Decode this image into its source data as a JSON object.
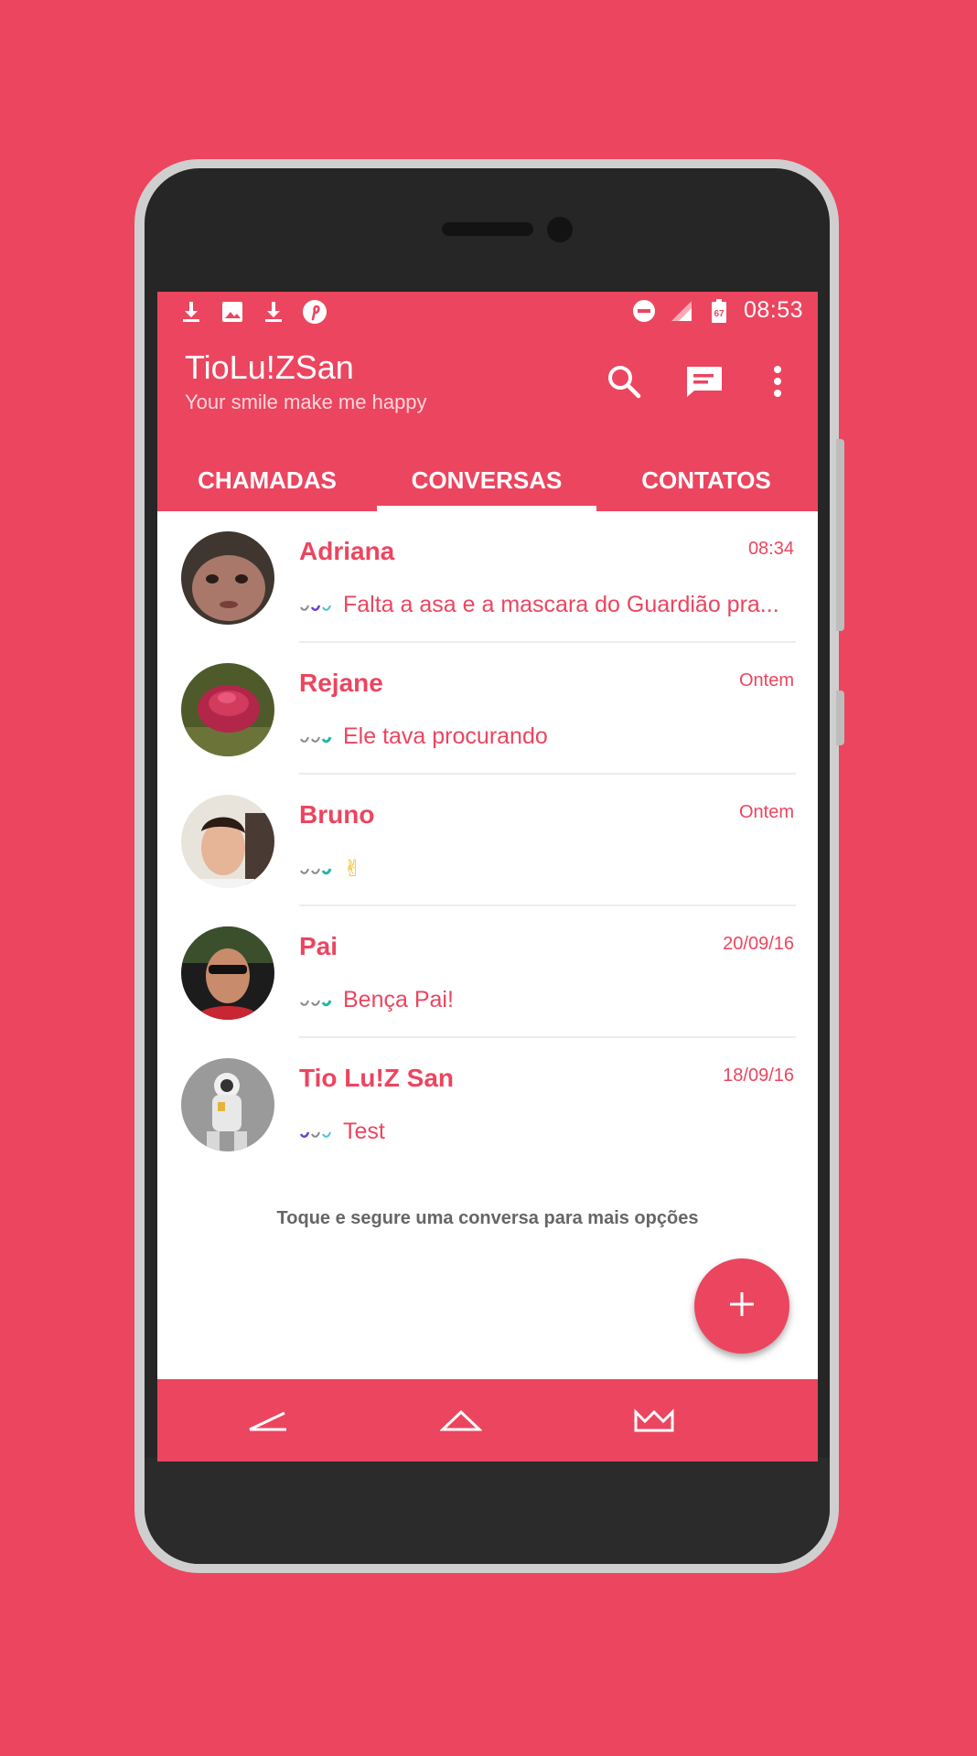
{
  "app": {
    "title": "TioLu!ZSan",
    "subtitle": "Your smile make me happy",
    "accent_color": "#ec455f"
  },
  "status_bar": {
    "time": "08:53",
    "left_icons": [
      "download-icon",
      "image-icon",
      "download-icon",
      "pinterest-icon"
    ],
    "right_icons": [
      "do-not-disturb-icon",
      "signal-icon",
      "battery-icon"
    ]
  },
  "toolbar": {
    "actions": [
      "search-icon",
      "new-message-icon",
      "more-vert-icon"
    ]
  },
  "tabs": [
    {
      "label": "CHAMADAS",
      "selected": false
    },
    {
      "label": "CONVERSAS",
      "selected": true
    },
    {
      "label": "CONTATOS",
      "selected": false
    }
  ],
  "chats": [
    {
      "name": "Adriana",
      "time": "08:34",
      "message": "Falta a asa e a mascara do Guardião pra..."
    },
    {
      "name": "Rejane",
      "time": "Ontem",
      "message": "Ele tava procurando"
    },
    {
      "name": "Bruno",
      "time": "Ontem",
      "message": "✌"
    },
    {
      "name": "Pai",
      "time": "20/09/16",
      "message": "Bença Pai!"
    },
    {
      "name": "Tio Lu!Z San",
      "time": "18/09/16",
      "message": "Test"
    }
  ],
  "hint": "Toque e segure uma conversa para mais opções",
  "fab": {
    "icon": "plus-icon"
  },
  "navbar": {
    "icons": [
      "back-icon",
      "home-icon",
      "crown-icon"
    ]
  }
}
